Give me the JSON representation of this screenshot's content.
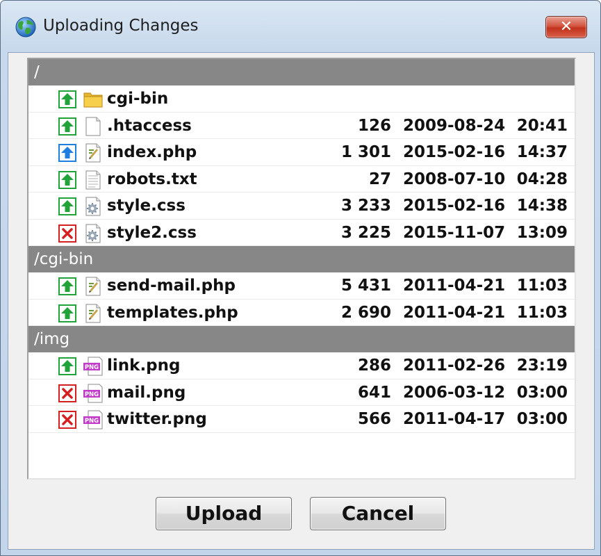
{
  "window": {
    "title": "Uploading Changes",
    "close_label": "✕"
  },
  "groups": [
    {
      "path": "/",
      "files": [
        {
          "status": "upload-new",
          "type": "folder",
          "name": "cgi-bin",
          "size": "",
          "date": "",
          "time": ""
        },
        {
          "status": "upload-new",
          "type": "text",
          "name": ".htaccess",
          "size": "126",
          "date": "2009-08-24",
          "time": "20:41"
        },
        {
          "status": "upload-changed",
          "type": "php",
          "name": "index.php",
          "size": "1 301",
          "date": "2015-02-16",
          "time": "14:37"
        },
        {
          "status": "upload-new",
          "type": "text-lines",
          "name": "robots.txt",
          "size": "27",
          "date": "2008-07-10",
          "time": "04:28"
        },
        {
          "status": "upload-new",
          "type": "css",
          "name": "style.css",
          "size": "3 233",
          "date": "2015-02-16",
          "time": "14:38"
        },
        {
          "status": "delete",
          "type": "css",
          "name": "style2.css",
          "size": "3 225",
          "date": "2015-11-07",
          "time": "13:09"
        }
      ]
    },
    {
      "path": "/cgi-bin",
      "files": [
        {
          "status": "upload-new",
          "type": "php",
          "name": "send-mail.php",
          "size": "5 431",
          "date": "2011-04-21",
          "time": "11:03"
        },
        {
          "status": "upload-new",
          "type": "php",
          "name": "templates.php",
          "size": "2 690",
          "date": "2011-04-21",
          "time": "11:03"
        }
      ]
    },
    {
      "path": "/img",
      "files": [
        {
          "status": "upload-new",
          "type": "png",
          "name": "link.png",
          "size": "286",
          "date": "2011-02-26",
          "time": "23:19"
        },
        {
          "status": "delete",
          "type": "png",
          "name": "mail.png",
          "size": "641",
          "date": "2006-03-12",
          "time": "03:00"
        },
        {
          "status": "delete",
          "type": "png",
          "name": "twitter.png",
          "size": "566",
          "date": "2011-04-17",
          "time": "03:00"
        }
      ]
    }
  ],
  "file_icon_label": "PNG",
  "buttons": {
    "upload": "Upload",
    "cancel": "Cancel"
  },
  "colors": {
    "upload_new": "#22a33a",
    "upload_changed": "#1e7fe0",
    "delete": "#d42020",
    "group_header_bg": "#878787"
  }
}
